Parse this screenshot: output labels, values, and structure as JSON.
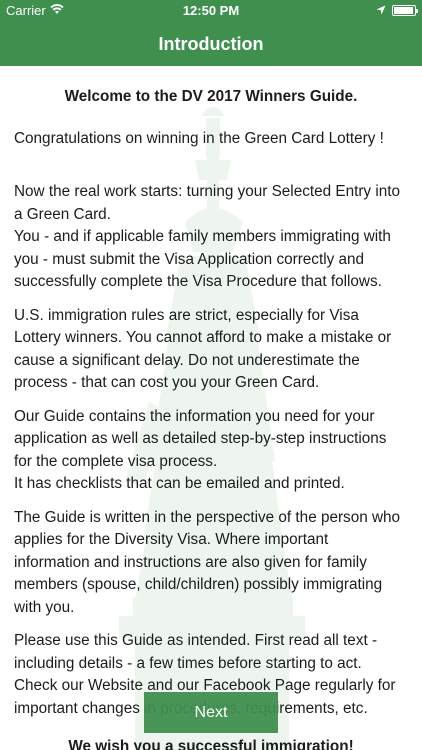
{
  "status_bar": {
    "carrier": "Carrier",
    "time": "12:50 PM"
  },
  "nav": {
    "title": "Introduction"
  },
  "content": {
    "heading": "Welcome to the DV 2017 Winners Guide.",
    "congratulations": "Congratulations on winning in the Green Card Lottery !",
    "paragraph_real_work": "Now the real work starts: turning your Selected Entry into a Green Card.",
    "paragraph_you": "You - and if applicable family members immigrating with you - must submit the Visa Application correctly and successfully complete the Visa Procedure that follows.",
    "paragraph_rules": "U.S. immigration rules are strict, especially for Visa Lottery winners. You cannot afford to make a mistake or cause a significant delay. Do not underestimate the process - that can cost you your Green Card.",
    "paragraph_guide": "Our Guide contains the information you need for your application as well as detailed step-by-step instructions for the complete visa process.",
    "paragraph_checklists": "It has checklists that can be emailed and printed.",
    "paragraph_perspective": "The Guide is written in the perspective of the person who applies for the Diversity Visa. Where important information and instructions are also given for family members (spouse, child/children) possibly immigrating with you.",
    "paragraph_use": "Please use this Guide as intended. First read all text - including details - a few times before starting to act. Check our Website and our Facebook Page regularly for important changes in procedures, requirements, etc.",
    "cutoff_line": "We wish you a successful immigration!"
  },
  "next_button": {
    "label": "Next"
  },
  "colors": {
    "brand_green": "#3f8f4f",
    "text": "#1c1c1c",
    "watermark": "#cfe5d2"
  },
  "icons": {
    "wifi": "wifi-icon",
    "location": "location-arrow-icon",
    "battery": "battery-icon"
  }
}
